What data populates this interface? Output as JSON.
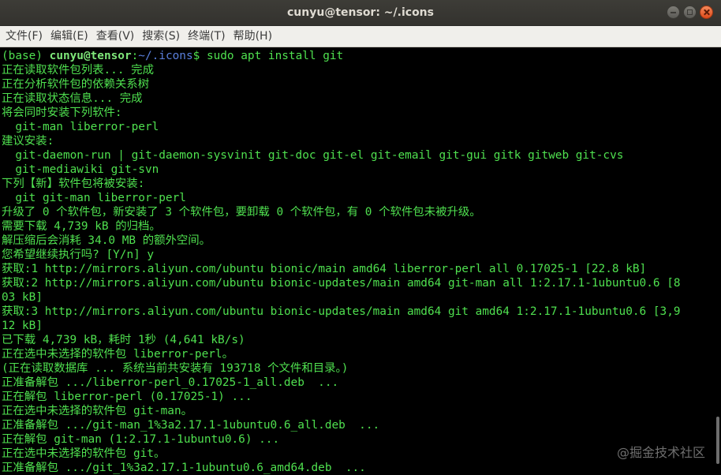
{
  "window": {
    "title": "cunyu@tensor: ~/.icons"
  },
  "menu": [
    {
      "label": "文件(F)"
    },
    {
      "label": "编辑(E)"
    },
    {
      "label": "查看(V)"
    },
    {
      "label": "搜索(S)"
    },
    {
      "label": "终端(T)"
    },
    {
      "label": "帮助(H)"
    }
  ],
  "prompt": {
    "env": "(base) ",
    "user_host": "cunyu@tensor",
    "colon": ":",
    "path": "~/.icons",
    "symbol": "$ ",
    "command": "sudo apt install git"
  },
  "output_lines": [
    "正在读取软件包列表... 完成",
    "正在分析软件包的依赖关系树",
    "正在读取状态信息... 完成",
    "将会同时安装下列软件:",
    "  git-man liberror-perl",
    "建议安装:",
    "  git-daemon-run | git-daemon-sysvinit git-doc git-el git-email git-gui gitk gitweb git-cvs",
    "  git-mediawiki git-svn",
    "下列【新】软件包将被安装:",
    "  git git-man liberror-perl",
    "升级了 0 个软件包，新安装了 3 个软件包，要卸载 0 个软件包，有 0 个软件包未被升级。",
    "需要下载 4,739 kB 的归档。",
    "解压缩后会消耗 34.0 MB 的额外空间。",
    "您希望继续执行吗? [Y/n] y",
    "获取:1 http://mirrors.aliyun.com/ubuntu bionic/main amd64 liberror-perl all 0.17025-1 [22.8 kB]",
    "获取:2 http://mirrors.aliyun.com/ubuntu bionic-updates/main amd64 git-man all 1:2.17.1-1ubuntu0.6 [8",
    "03 kB]",
    "获取:3 http://mirrors.aliyun.com/ubuntu bionic-updates/main amd64 git amd64 1:2.17.1-1ubuntu0.6 [3,9",
    "12 kB]",
    "已下载 4,739 kB，耗时 1秒 (4,641 kB/s)",
    "正在选中未选择的软件包 liberror-perl。",
    "(正在读取数据库 ... 系统当前共安装有 193718 个文件和目录。)",
    "正准备解包 .../liberror-perl_0.17025-1_all.deb  ...",
    "正在解包 liberror-perl (0.17025-1) ...",
    "正在选中未选择的软件包 git-man。",
    "正准备解包 .../git-man_1%3a2.17.1-1ubuntu0.6_all.deb  ...",
    "正在解包 git-man (1:2.17.1-1ubuntu0.6) ...",
    "正在选中未选择的软件包 git。",
    "正准备解包 .../git_1%3a2.17.1-1ubuntu0.6_amd64.deb  ..."
  ],
  "watermark": "@掘金技术社区",
  "colors": {
    "terminal_bg": "#000000",
    "terminal_text": "#4fe04f",
    "prompt_path": "#5a7fdc",
    "titlebar_bg": "#3a3935",
    "menubar_bg": "#f0efeb"
  }
}
